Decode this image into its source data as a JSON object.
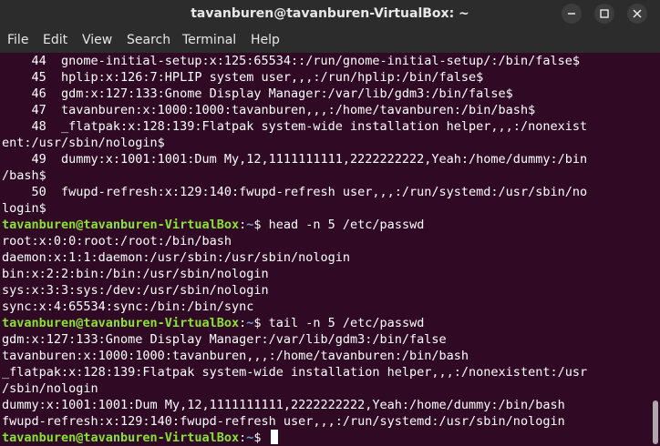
{
  "window": {
    "title": "tavanburen@tavanburen-VirtualBox: ~"
  },
  "menu": [
    "File",
    "Edit",
    "View",
    "Search",
    "Terminal",
    "Help"
  ],
  "terminal": {
    "lines": [
      {
        "type": "text",
        "text": "    44  gnome-initial-setup:x:125:65534::/run/gnome-initial-setup/:/bin/false$"
      },
      {
        "type": "text",
        "text": "    45  hplip:x:126:7:HPLIP system user,,,:/run/hplip:/bin/false$"
      },
      {
        "type": "text",
        "text": "    46  gdm:x:127:133:Gnome Display Manager:/var/lib/gdm3:/bin/false$"
      },
      {
        "type": "text",
        "text": "    47  tavanburen:x:1000:1000:tavanburen,,,:/home/tavanburen:/bin/bash$"
      },
      {
        "type": "text",
        "text": "    48  _flatpak:x:128:139:Flatpak system-wide installation helper,,,:/nonexist"
      },
      {
        "type": "text",
        "text": "ent:/usr/sbin/nologin$"
      },
      {
        "type": "text",
        "text": "    49  dummy:x:1001:1001:Dum My,12,1111111111,2222222222,Yeah:/home/dummy:/bin"
      },
      {
        "type": "text",
        "text": "/bash$"
      },
      {
        "type": "text",
        "text": "    50  fwupd-refresh:x:129:140:fwupd-refresh user,,,:/run/systemd:/usr/sbin/no"
      },
      {
        "type": "text",
        "text": "login$"
      },
      {
        "type": "prompt",
        "user": "tavanburen@tavanburen-VirtualBox",
        "path": "~",
        "symbol": "$",
        "command": " head -n 5 /etc/passwd"
      },
      {
        "type": "text",
        "text": "root:x:0:0:root:/root:/bin/bash"
      },
      {
        "type": "text",
        "text": "daemon:x:1:1:daemon:/usr/sbin:/usr/sbin/nologin"
      },
      {
        "type": "text",
        "text": "bin:x:2:2:bin:/bin:/usr/sbin/nologin"
      },
      {
        "type": "text",
        "text": "sys:x:3:3:sys:/dev:/usr/sbin/nologin"
      },
      {
        "type": "text",
        "text": "sync:x:4:65534:sync:/bin:/bin/sync"
      },
      {
        "type": "prompt",
        "user": "tavanburen@tavanburen-VirtualBox",
        "path": "~",
        "symbol": "$",
        "command": " tail -n 5 /etc/passwd"
      },
      {
        "type": "text",
        "text": "gdm:x:127:133:Gnome Display Manager:/var/lib/gdm3:/bin/false"
      },
      {
        "type": "text",
        "text": "tavanburen:x:1000:1000:tavanburen,,,:/home/tavanburen:/bin/bash"
      },
      {
        "type": "text",
        "text": "_flatpak:x:128:139:Flatpak system-wide installation helper,,,:/nonexistent:/usr"
      },
      {
        "type": "text",
        "text": "/sbin/nologin"
      },
      {
        "type": "text",
        "text": "dummy:x:1001:1001:Dum My,12,1111111111,2222222222,Yeah:/home/dummy:/bin/bash"
      },
      {
        "type": "text",
        "text": "fwupd-refresh:x:129:140:fwupd-refresh user,,,:/run/systemd:/usr/sbin/nologin"
      },
      {
        "type": "prompt",
        "user": "tavanburen@tavanburen-VirtualBox",
        "path": "~",
        "symbol": "$",
        "command": " ",
        "cursor": true
      }
    ]
  },
  "colors": {
    "terminal_bg": "#300a24",
    "prompt_user": "#8ae234",
    "prompt_path": "#729fcf",
    "text": "#ffffff",
    "titlebar_bg": "#2c2c2c"
  }
}
